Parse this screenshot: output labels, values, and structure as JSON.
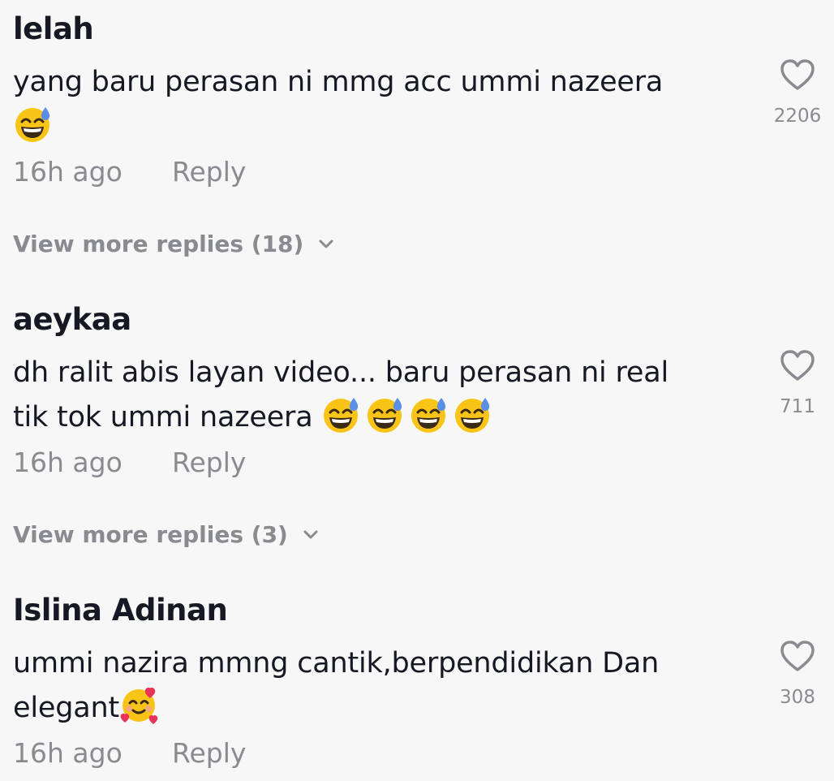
{
  "comments": [
    {
      "username": "lelah",
      "text": "yang baru perasan ni mmg acc ummi nazeera",
      "emoji_names": [
        "grinning-sweat-emoji"
      ],
      "time": "16h ago",
      "reply_label": "Reply",
      "likes": "2206",
      "view_more": "View more replies (18)"
    },
    {
      "username": "aeykaa",
      "text_line1": "dh ralit abis layan video... baru perasan ni real",
      "text_line2": "tik tok ummi nazeera",
      "emoji_names": [
        "grinning-sweat-emoji",
        "grinning-sweat-emoji",
        "grinning-sweat-emoji",
        "grinning-sweat-emoji"
      ],
      "time": "16h ago",
      "reply_label": "Reply",
      "likes": "711",
      "view_more": "View more replies (3)"
    },
    {
      "username": "Islina Adinan",
      "text_line1": "ummi nazira mmng cantik,berpendidikan Dan",
      "text_line2": "elegant",
      "emoji_names": [
        "smiling-face-with-hearts-emoji"
      ],
      "time": "16h ago",
      "reply_label": "Reply",
      "likes": "308"
    }
  ],
  "colors": {
    "background": "#f7f7f7",
    "primary_text": "#161823",
    "secondary_text": "#8a8b91"
  },
  "icons": {
    "like": "heart-outline-icon",
    "expand": "chevron-down-icon"
  }
}
